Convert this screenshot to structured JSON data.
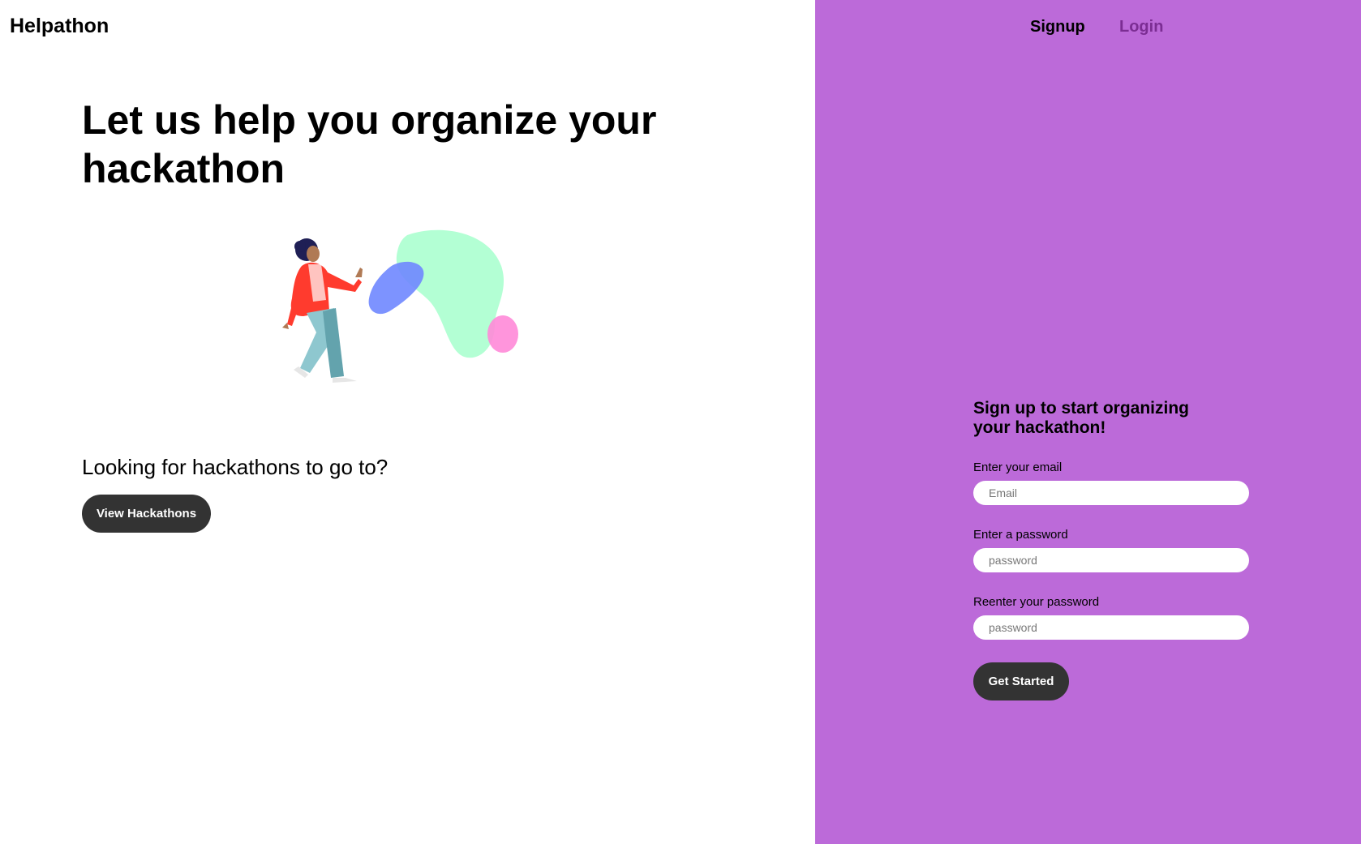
{
  "header": {
    "brand": "Helpathon"
  },
  "nav": {
    "signup_label": "Signup",
    "login_label": "Login"
  },
  "hero": {
    "headline": "Let us help you organize your hackathon",
    "subheadline": "Looking for hackathons to go to?",
    "view_button_label": "View Hackathons",
    "illustration_icon": "person-walking-illustration"
  },
  "signup_form": {
    "title": "Sign up to start organizing your hackathon!",
    "email_label": "Enter your email",
    "email_placeholder": "Email",
    "password_label": "Enter a password",
    "password_placeholder": "password",
    "confirm_label": "Reenter your password",
    "confirm_placeholder": "password",
    "submit_label": "Get Started"
  },
  "colors": {
    "panel_background": "#bc6ad9",
    "button_background": "#333333",
    "login_link": "#7b2d93",
    "page_background": "#ffffff"
  }
}
